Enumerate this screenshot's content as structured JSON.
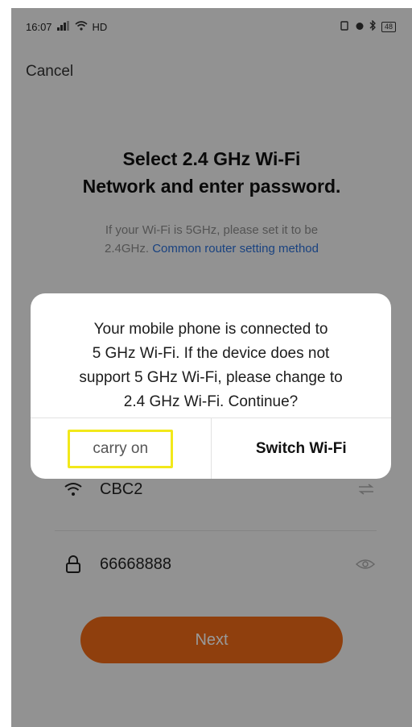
{
  "status_bar": {
    "time": "16:07",
    "network": "HD",
    "battery": "48"
  },
  "header": {
    "cancel_label": "Cancel"
  },
  "main": {
    "title_line1": "Select 2.4 GHz Wi-Fi",
    "title_line2": "Network and enter password.",
    "hint_line1": "If your Wi-Fi is 5GHz, please set it to be",
    "hint_prefix": "2.4GHz.",
    "hint_link": "Common router setting method",
    "wifi_name": "CBC2",
    "password": "66668888",
    "next_label": "Next"
  },
  "dialog": {
    "message_line1": "Your mobile phone is connected to",
    "message_line2": "5 GHz Wi-Fi. If the device does not",
    "message_line3": "support 5 GHz Wi-Fi, please change to",
    "message_line4": "2.4 GHz Wi-Fi. Continue?",
    "carry_on_label": "carry on",
    "switch_wifi_label": "Switch Wi-Fi"
  },
  "colors": {
    "accent": "#ef6a16",
    "link": "#2b6fd6",
    "highlight": "#f2e81a",
    "overlay": "rgba(0,0,0,0.40)"
  }
}
